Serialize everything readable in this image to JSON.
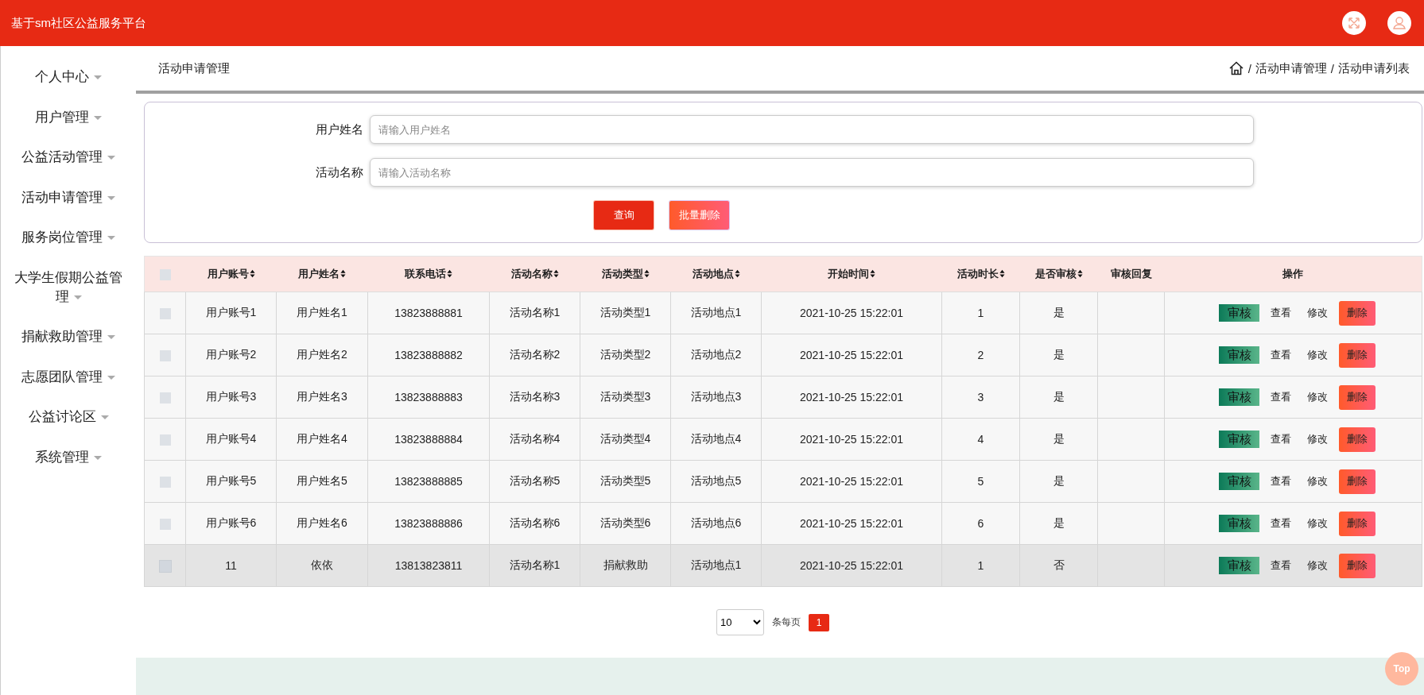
{
  "header": {
    "title": "基于sm社区公益服务平台"
  },
  "sidebar": {
    "items": [
      {
        "label": "个人中心"
      },
      {
        "label": "用户管理"
      },
      {
        "label": "公益活动管理"
      },
      {
        "label": "活动申请管理"
      },
      {
        "label": "服务岗位管理"
      },
      {
        "label": "大学生假期公益管理"
      },
      {
        "label": "捐献救助管理"
      },
      {
        "label": "志愿团队管理"
      },
      {
        "label": "公益讨论区"
      },
      {
        "label": "系统管理"
      }
    ]
  },
  "page_title": "活动申请管理",
  "breadcrumb": [
    {
      "separator": "/",
      "label": "活动申请管理"
    },
    {
      "separator": "/",
      "label": "活动申请列表"
    }
  ],
  "search": {
    "fields": [
      {
        "label": "用户姓名",
        "placeholder": "请输入用户姓名"
      },
      {
        "label": "活动名称",
        "placeholder": "请输入活动名称"
      }
    ],
    "buttons": [
      {
        "label": "查询",
        "kind": "primary"
      },
      {
        "label": "批量删除",
        "kind": "danger"
      }
    ]
  },
  "table": {
    "select_all": {
      "checked": false
    },
    "columns": [
      {
        "label": "用户账号",
        "sortable": true
      },
      {
        "label": "用户姓名",
        "sortable": true
      },
      {
        "label": "联系电话",
        "sortable": true
      },
      {
        "label": "活动名称",
        "sortable": true
      },
      {
        "label": "活动类型",
        "sortable": true
      },
      {
        "label": "活动地点",
        "sortable": true
      },
      {
        "label": "开始时间",
        "sortable": true
      },
      {
        "label": "活动时长",
        "sortable": true
      },
      {
        "label": "是否审核",
        "sortable": true
      },
      {
        "label": "审核回复",
        "sortable": false
      },
      {
        "label": "操作",
        "sortable": false
      }
    ],
    "rows": [
      {
        "checked": false,
        "highlighted": false,
        "cells": [
          "用户账号1",
          "用户姓名1",
          "13823888881",
          "活动名称1",
          "活动类型1",
          "活动地点1",
          "2021-10-25 15:22:01",
          "1",
          "是"
        ],
        "actions": [
          {
            "label": "审核",
            "kind": "audit"
          },
          {
            "label": "查看",
            "kind": "view"
          },
          {
            "label": "修改",
            "kind": "edit"
          },
          {
            "label": "删除",
            "kind": "delete"
          }
        ]
      },
      {
        "checked": false,
        "highlighted": false,
        "cells": [
          "用户账号2",
          "用户姓名2",
          "13823888882",
          "活动名称2",
          "活动类型2",
          "活动地点2",
          "2021-10-25 15:22:01",
          "2",
          "是"
        ],
        "actions": [
          {
            "label": "审核",
            "kind": "audit"
          },
          {
            "label": "查看",
            "kind": "view"
          },
          {
            "label": "修改",
            "kind": "edit"
          },
          {
            "label": "删除",
            "kind": "delete"
          }
        ]
      },
      {
        "checked": false,
        "highlighted": false,
        "cells": [
          "用户账号3",
          "用户姓名3",
          "13823888883",
          "活动名称3",
          "活动类型3",
          "活动地点3",
          "2021-10-25 15:22:01",
          "3",
          "是"
        ],
        "actions": [
          {
            "label": "审核",
            "kind": "audit"
          },
          {
            "label": "查看",
            "kind": "view"
          },
          {
            "label": "修改",
            "kind": "edit"
          },
          {
            "label": "删除",
            "kind": "delete"
          }
        ]
      },
      {
        "checked": false,
        "highlighted": false,
        "cells": [
          "用户账号4",
          "用户姓名4",
          "13823888884",
          "活动名称4",
          "活动类型4",
          "活动地点4",
          "2021-10-25 15:22:01",
          "4",
          "是"
        ],
        "actions": [
          {
            "label": "审核",
            "kind": "audit"
          },
          {
            "label": "查看",
            "kind": "view"
          },
          {
            "label": "修改",
            "kind": "edit"
          },
          {
            "label": "删除",
            "kind": "delete"
          }
        ]
      },
      {
        "checked": false,
        "highlighted": false,
        "cells": [
          "用户账号5",
          "用户姓名5",
          "13823888885",
          "活动名称5",
          "活动类型5",
          "活动地点5",
          "2021-10-25 15:22:01",
          "5",
          "是"
        ],
        "actions": [
          {
            "label": "审核",
            "kind": "audit"
          },
          {
            "label": "查看",
            "kind": "view"
          },
          {
            "label": "修改",
            "kind": "edit"
          },
          {
            "label": "删除",
            "kind": "delete"
          }
        ]
      },
      {
        "checked": false,
        "highlighted": false,
        "cells": [
          "用户账号6",
          "用户姓名6",
          "13823888886",
          "活动名称6",
          "活动类型6",
          "活动地点6",
          "2021-10-25 15:22:01",
          "6",
          "是"
        ],
        "actions": [
          {
            "label": "审核",
            "kind": "audit"
          },
          {
            "label": "查看",
            "kind": "view"
          },
          {
            "label": "修改",
            "kind": "edit"
          },
          {
            "label": "删除",
            "kind": "delete"
          }
        ]
      },
      {
        "checked": false,
        "highlighted": true,
        "cells": [
          "11",
          "依依",
          "13813823811",
          "活动名称1",
          "捐献救助",
          "活动地点1",
          "2021-10-25 15:22:01",
          "1",
          "否"
        ],
        "actions": [
          {
            "label": "审核",
            "kind": "audit"
          },
          {
            "label": "查看",
            "kind": "view"
          },
          {
            "label": "修改",
            "kind": "edit"
          },
          {
            "label": "删除",
            "kind": "delete"
          }
        ]
      }
    ]
  },
  "pagination": {
    "page_size": "10",
    "page_size_label": "条每页",
    "pages": [
      {
        "label": "1",
        "selected": true
      }
    ]
  },
  "top_button": "Top"
}
